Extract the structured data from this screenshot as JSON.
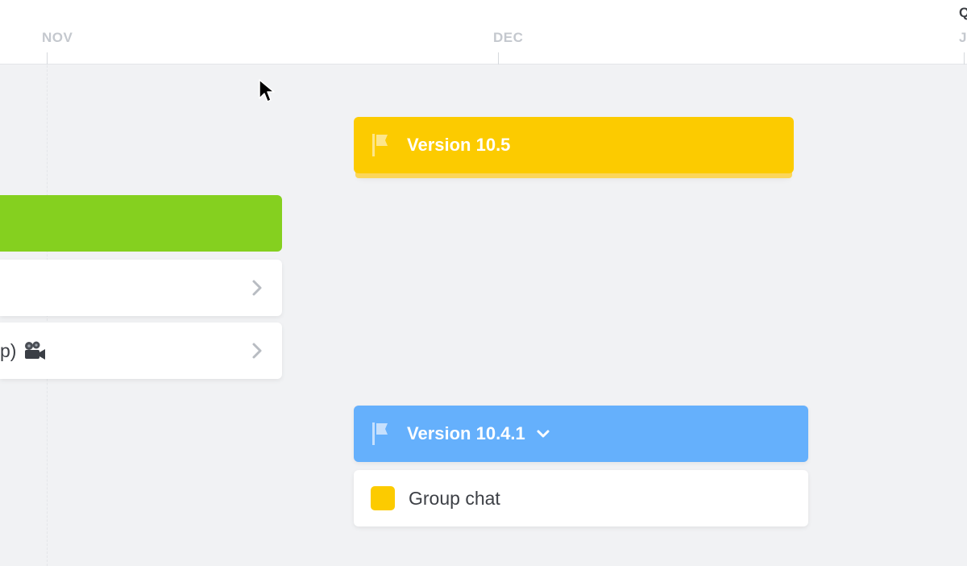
{
  "header": {
    "months": [
      "NOV",
      "DEC"
    ],
    "next_month_partial": "J",
    "quarter_partial": "Q"
  },
  "releases": [
    {
      "name": "Version 10.5",
      "color": "#fccb00",
      "icon": "flag-icon"
    },
    {
      "name": "Version 10.4.1",
      "color": "#65b0fc",
      "icon": "flag-icon",
      "expand_icon": "chevron-down-icon"
    }
  ],
  "left_lane": {
    "bar_color": "#85d01f",
    "cards": [
      {
        "text": "",
        "icon": "chevron-right-icon"
      },
      {
        "text": "p)",
        "emoji_icon": "movie-camera-icon",
        "icon": "chevron-right-icon"
      }
    ]
  },
  "release_items": [
    {
      "label": "Group chat",
      "swatch_color": "#fccb00"
    }
  ]
}
